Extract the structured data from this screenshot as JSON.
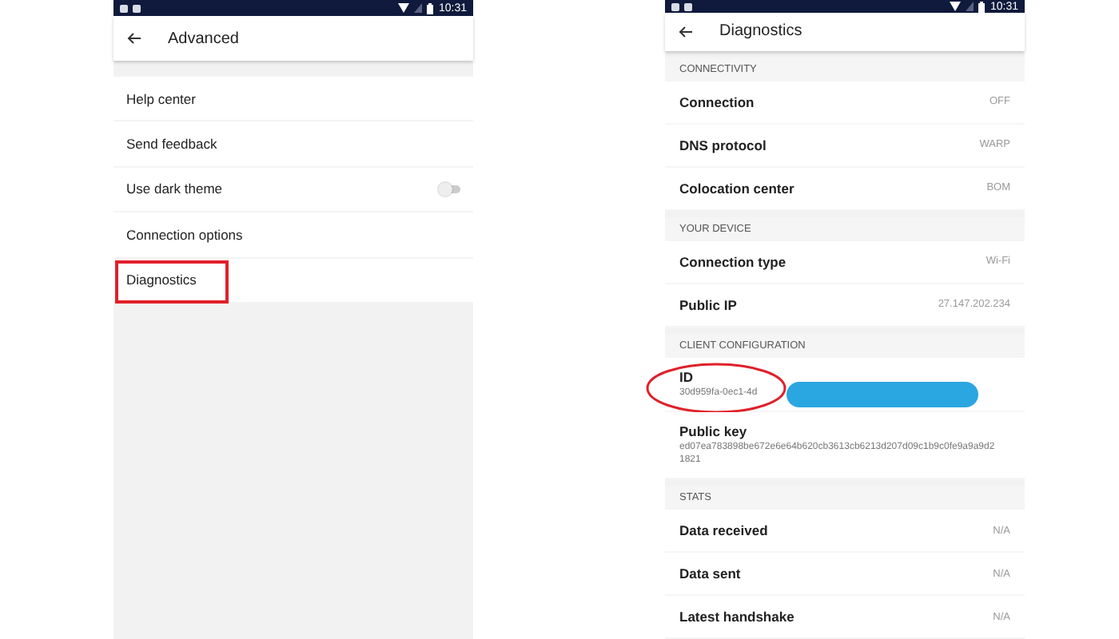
{
  "screens": [
    {
      "status_bar": {
        "time": "10:31"
      },
      "app_bar": {
        "title": "Advanced"
      },
      "items": [
        {
          "kind": "link",
          "label": "Help center",
          "highlighted": false
        },
        {
          "kind": "link",
          "label": "Send feedback",
          "highlighted": false
        },
        {
          "kind": "switch",
          "label": "Use dark theme",
          "on": false,
          "highlighted": false
        },
        {
          "kind": "link",
          "label": "Connection options",
          "highlighted": false
        },
        {
          "kind": "link",
          "label": "Diagnostics",
          "highlighted": true
        }
      ]
    },
    {
      "status_bar": {
        "time": "10:31"
      },
      "app_bar": {
        "title": "Diagnostics"
      },
      "sections": [
        {
          "header": "CONNECTIVITY",
          "rows": [
            {
              "kind": "inline",
              "label": "Connection",
              "value": "OFF"
            },
            {
              "kind": "inline",
              "label": "DNS protocol",
              "value": "WARP"
            },
            {
              "kind": "inline",
              "label": "Colocation center",
              "value": "BOM"
            }
          ]
        },
        {
          "header": "YOUR DEVICE",
          "rows": [
            {
              "kind": "inline",
              "label": "Connection type",
              "value": "Wi-Fi"
            },
            {
              "kind": "inline",
              "label": "Public IP",
              "value": "27.147.202.234"
            }
          ]
        },
        {
          "header": "CLIENT CONFIGURATION",
          "rows": [
            {
              "kind": "stacked",
              "label": "ID",
              "value": "30d959fa-0ec1-4d",
              "circled": true,
              "redacted": true
            },
            {
              "kind": "stacked",
              "label": "Public key",
              "value": "ed07ea783898be672e6e64b620cb3613cb6213d207d09c1b9c0fe9a9a9d21821",
              "circled": false,
              "redacted": false
            }
          ]
        },
        {
          "header": "STATS",
          "rows": [
            {
              "kind": "inline",
              "label": "Data received",
              "value": "N/A"
            },
            {
              "kind": "inline",
              "label": "Data sent",
              "value": "N/A"
            },
            {
              "kind": "inline",
              "label": "Latest handshake",
              "value": "N/A"
            }
          ]
        }
      ]
    }
  ]
}
